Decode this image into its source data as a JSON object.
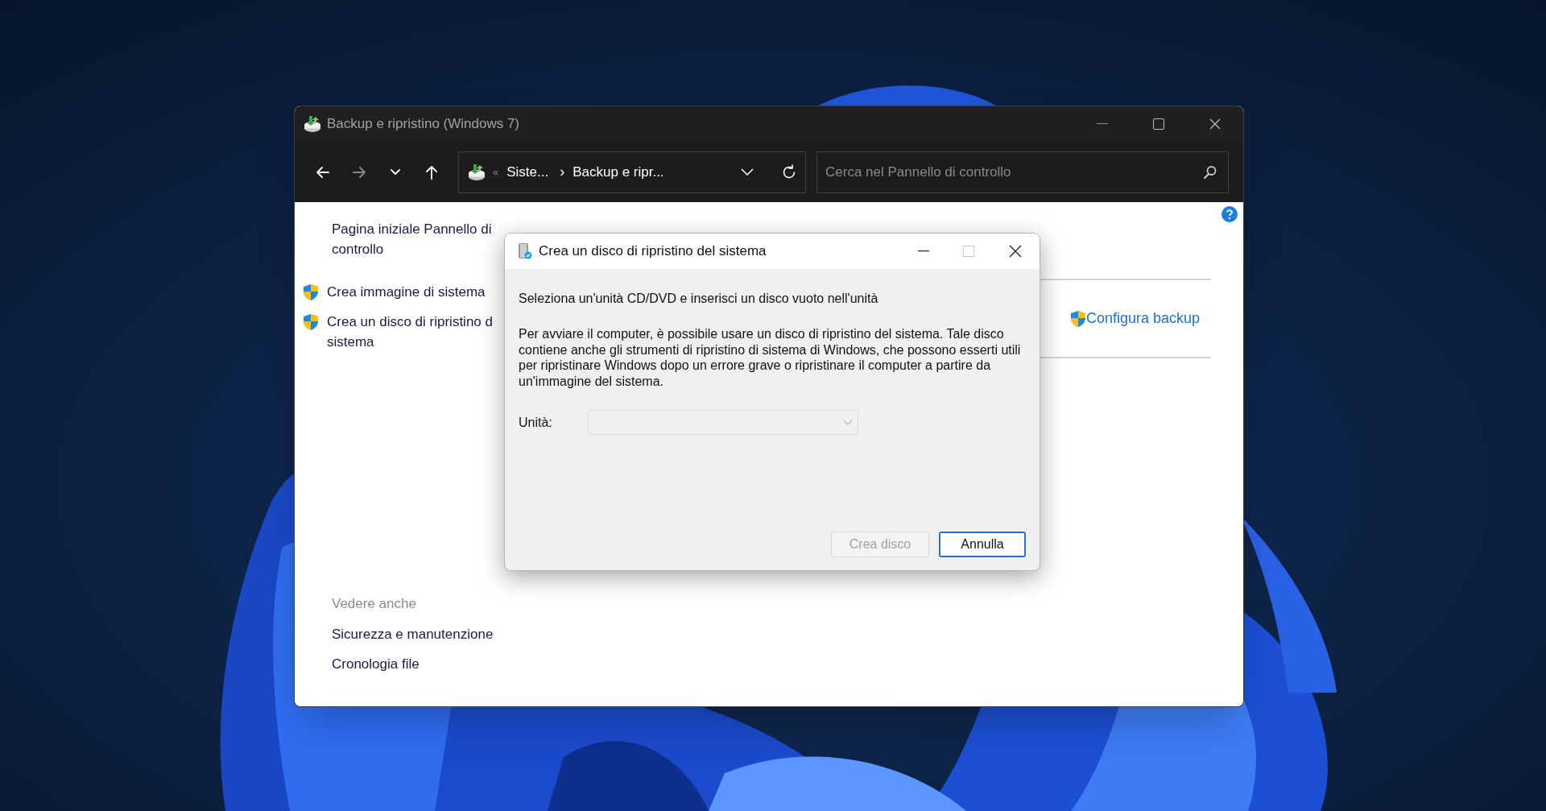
{
  "window": {
    "title": "Backup e ripristino (Windows 7)"
  },
  "nav": {
    "buttons": [
      {
        "kind": "back",
        "disabled": false
      },
      {
        "kind": "forward",
        "disabled": true
      },
      {
        "kind": "recent",
        "disabled": false
      },
      {
        "kind": "up",
        "disabled": false
      }
    ],
    "address": {
      "overflow": "«",
      "crumbs": [
        "Siste...",
        "Backup e ripr..."
      ],
      "separator": "›"
    },
    "search": {
      "placeholder": "Cerca nel Pannello di controllo"
    }
  },
  "sidebar": {
    "home": "Pagina iniziale Pannello di controllo",
    "tasks": [
      {
        "lines": [
          "Crea immagine di sistema"
        ]
      },
      {
        "lines": [
          "Crea un disco di ripristino d",
          "sistema"
        ]
      }
    ],
    "see_also": {
      "heading": "Vedere anche",
      "links": [
        "Sicurezza e manutenzione",
        "Cronologia file"
      ]
    }
  },
  "main": {
    "configure_link": "Configura backup"
  },
  "dialog": {
    "title": "Crea un disco di ripristino del sistema",
    "maximize_disabled": true,
    "instruction": "Seleziona un'unità CD/DVD e inserisci un disco vuoto nell'unità",
    "description": "Per avviare il computer, è possibile usare un disco di ripristino del sistema. Tale disco contiene anche gli strumenti di ripristino di sistema di Windows, che possono esserti utili per ripristinare Windows dopo un errore grave o ripristinare il computer a partire da un'immagine del sistema.",
    "drive": {
      "label": "Unità:",
      "disabled": true
    },
    "buttons": [
      {
        "label": "Crea disco",
        "disabled": true,
        "default": false
      },
      {
        "label": "Annulla",
        "disabled": false,
        "default": true
      }
    ]
  }
}
